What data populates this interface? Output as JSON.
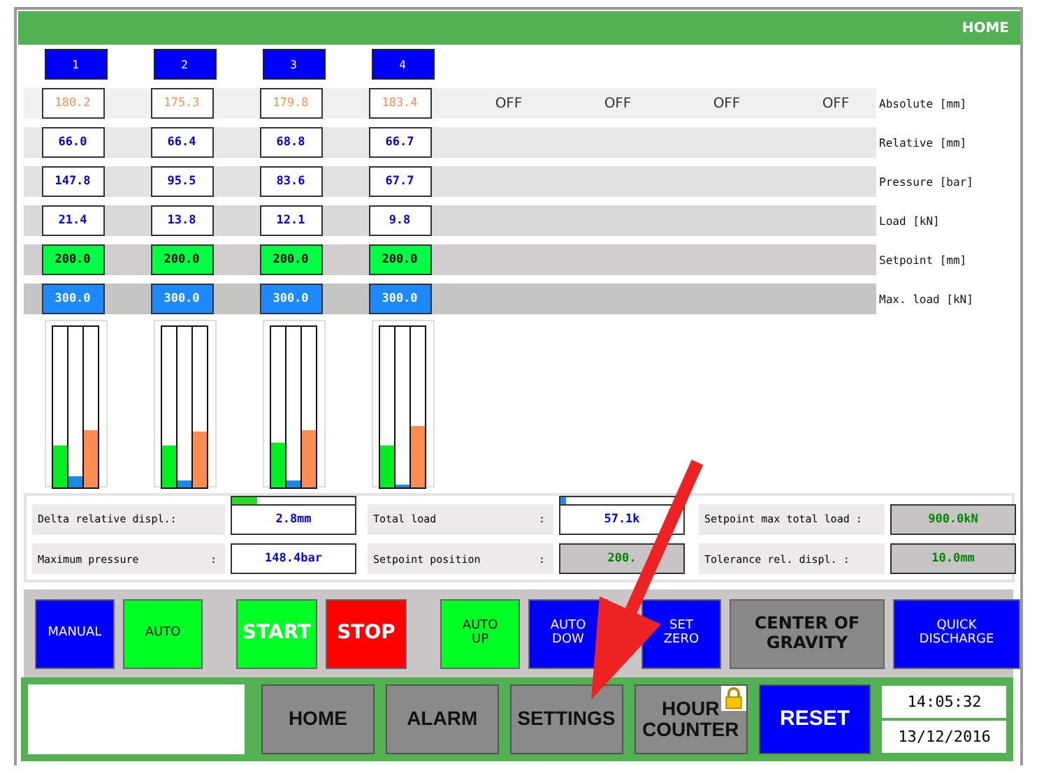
{
  "header": {
    "title": "HOME"
  },
  "channels": [
    {
      "label": "1",
      "meters": [
        {
          "level": 0.26,
          "color": "#00ee22"
        },
        {
          "level": 0.07,
          "color": "#1e88e5"
        },
        {
          "level": 0.36,
          "color": "#ff8c50"
        }
      ]
    },
    {
      "label": "2",
      "meters": [
        {
          "level": 0.26,
          "color": "#00ee22"
        },
        {
          "level": 0.04,
          "color": "#1e88e5"
        },
        {
          "level": 0.35,
          "color": "#ff8c50"
        }
      ]
    },
    {
      "label": "3",
      "meters": [
        {
          "level": 0.28,
          "color": "#00ee22"
        },
        {
          "level": 0.04,
          "color": "#1e88e5"
        },
        {
          "level": 0.36,
          "color": "#ff8c50"
        }
      ]
    },
    {
      "label": "4",
      "meters": [
        {
          "level": 0.26,
          "color": "#00ee22"
        },
        {
          "level": 0.02,
          "color": "#1e88e5"
        },
        {
          "level": 0.38,
          "color": "#ff8c50"
        }
      ]
    }
  ],
  "rows": [
    {
      "kind": "actual",
      "label": "Absolute [mm]",
      "values": [
        "180.2",
        "175.3",
        "179.8",
        "183.4"
      ],
      "states": [
        "OFF",
        "OFF",
        "OFF",
        "OFF"
      ]
    },
    {
      "kind": "reading",
      "label": "Relative [mm]",
      "values": [
        "66.0",
        "66.4",
        "68.8",
        "66.7"
      ]
    },
    {
      "kind": "reading",
      "label": "Pressure [bar]",
      "values": [
        "147.8",
        "95.5",
        "83.6",
        "67.7"
      ]
    },
    {
      "kind": "reading",
      "label": "Load [kN]",
      "values": [
        "21.4",
        "13.8",
        "12.1",
        "9.8"
      ]
    },
    {
      "kind": "setpoint",
      "label": "Setpoint [mm]",
      "values": [
        "200.0",
        "200.0",
        "200.0",
        "200.0"
      ]
    },
    {
      "kind": "limit",
      "label": "Max. load [kN]",
      "values": [
        "300.0",
        "300.0",
        "300.0",
        "300.0"
      ]
    }
  ],
  "summary": [
    [
      {
        "label": "Delta relative displ.:",
        "value": "2.8mm",
        "kind": "display",
        "level": 0.2
      },
      {
        "label": "Total load",
        "colon": ":",
        "value": "57.1k",
        "kind": "display",
        "level": 0.05
      },
      {
        "label": "Setpoint max total load :",
        "value": "900.0kN",
        "kind": "setting"
      }
    ],
    [
      {
        "label": "Maximum pressure",
        "colon": ":",
        "value": "148.4bar",
        "kind": "display"
      },
      {
        "label": "Setpoint position",
        "colon": ":",
        "value": "200.",
        "kind": "setting"
      },
      {
        "label": "Tolerance rel. displ. :",
        "value": "10.0mm",
        "kind": "setting"
      }
    ]
  ],
  "button_groups": [
    [
      {
        "lines": [
          "MANUAL"
        ],
        "color": "#0000ff",
        "kind": "small"
      },
      {
        "lines": [
          "AUTO"
        ],
        "color": "#00ff22",
        "kind": "small"
      }
    ],
    [
      {
        "lines": [
          "START"
        ],
        "color": "#00ff22",
        "kind": "big"
      },
      {
        "lines": [
          "STOP"
        ],
        "color": "#ff0000",
        "kind": "big"
      }
    ],
    [
      {
        "lines": [
          "AUTO",
          "UP"
        ],
        "color": "#00ff22",
        "kind": "small"
      },
      {
        "lines": [
          "AUTO",
          "DOW"
        ],
        "color": "#0000ff",
        "kind": "small"
      }
    ],
    [
      {
        "lines": [
          "SET",
          "ZERO"
        ],
        "color": "#0000ff",
        "kind": "small"
      },
      {
        "lines": [
          "CENTER OF",
          "GRAVITY"
        ],
        "color": "#888888",
        "kind": "bold"
      },
      {
        "lines": [
          "QUICK",
          "DISCHARGE"
        ],
        "color": "#0000ff",
        "kind": "wide"
      }
    ]
  ],
  "nav": [
    {
      "lines": [
        "HOME"
      ],
      "kind": "nav",
      "locked": false
    },
    {
      "lines": [
        "ALARM"
      ],
      "kind": "nav",
      "locked": false
    },
    {
      "lines": [
        "SETTINGS"
      ],
      "kind": "nav",
      "locked": false
    },
    {
      "lines": [
        "HOUR",
        "COUNTER"
      ],
      "kind": "nav",
      "locked": true
    },
    {
      "lines": [
        "RESET"
      ],
      "kind": "reset",
      "locked": false
    }
  ],
  "clock": {
    "time": "14:05:32",
    "date": "13/12/2016"
  }
}
